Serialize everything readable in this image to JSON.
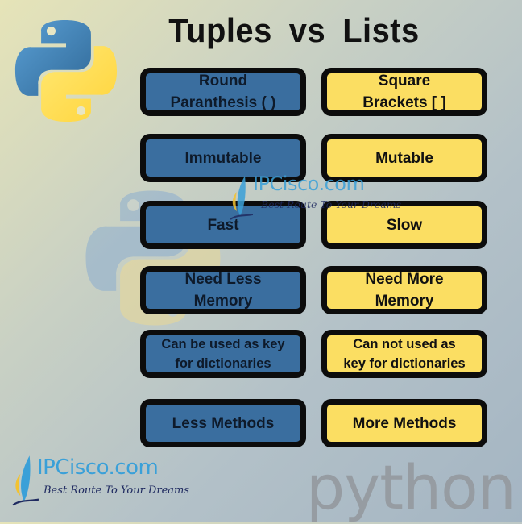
{
  "title": "Tuples  vs  Lists",
  "colors": {
    "tuple_box": "#3a6e9f",
    "list_box": "#fbde62",
    "border": "#0c0c0c",
    "brand_blue": "#3aa0d8"
  },
  "rows": [
    {
      "tuple": [
        "Round",
        "Paranthesis ( )"
      ],
      "list": [
        "Square",
        "Brackets [ ]"
      ]
    },
    {
      "tuple": [
        "Immutable"
      ],
      "list": [
        "Mutable"
      ]
    },
    {
      "tuple": [
        "Fast"
      ],
      "list": [
        "Slow"
      ]
    },
    {
      "tuple": [
        "Need Less",
        "Memory"
      ],
      "list": [
        "Need More",
        "Memory"
      ]
    },
    {
      "tuple": [
        "Can be used as key",
        "for dictionaries"
      ],
      "list": [
        "Can not used as",
        "key for dictionaries"
      ]
    },
    {
      "tuple": [
        "Less Methods"
      ],
      "list": [
        "More Methods"
      ]
    }
  ],
  "watermark": {
    "name": "IPCisco.com",
    "tagline": "Best Route To Your Dreams"
  },
  "footer_brand": {
    "name": "IPCisco.com",
    "tagline": "Best Route To Your Dreams"
  },
  "python_wordmark": "python",
  "icons": {
    "top_logo": "python-logo-icon",
    "bg_logo": "python-logo-icon",
    "brand": "sailboat-icon"
  }
}
